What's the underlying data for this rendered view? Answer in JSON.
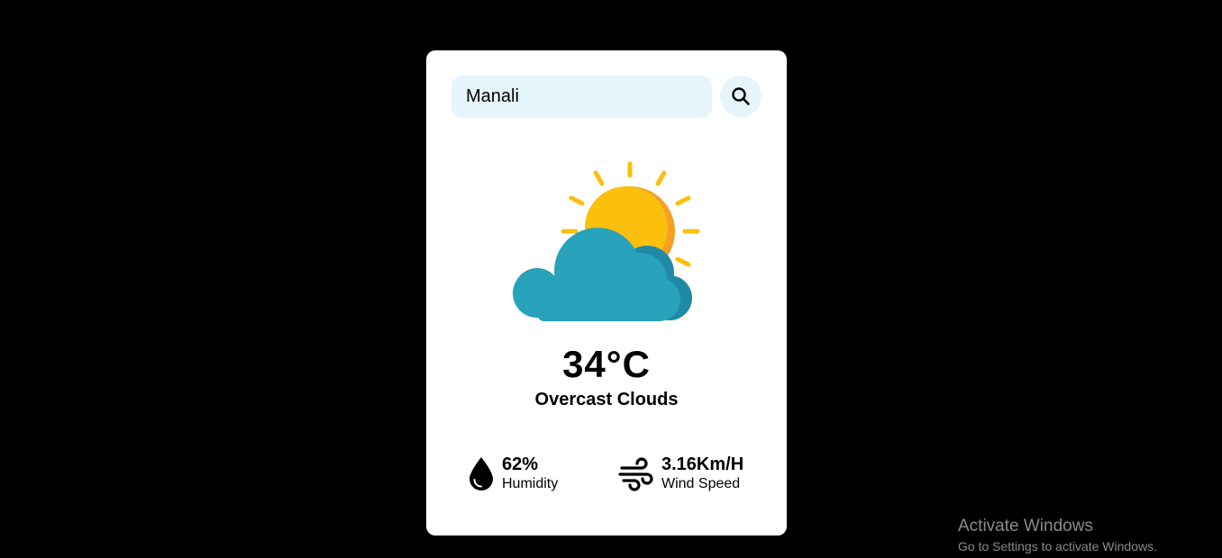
{
  "search": {
    "value": "Manali"
  },
  "weather": {
    "temperature": "34°C",
    "description": "Overcast Clouds",
    "icon": "partly-cloudy-icon"
  },
  "stats": {
    "humidity": {
      "value": "62%",
      "label": "Humidity",
      "icon": "water-drop-icon"
    },
    "wind": {
      "value": "3.16Km/H",
      "label": "Wind Speed",
      "icon": "wind-icon"
    }
  },
  "watermark": {
    "title": "Activate Windows",
    "subtitle": "Go to Settings to activate Windows."
  },
  "colors": {
    "background": "#000000",
    "card": "#ffffff",
    "input_bg": "#e6f4fb",
    "sun": "#fbbf0e",
    "sun_shade": "#f5a023",
    "cloud": "#29a3bc",
    "cloud_shade": "#1e8aa6"
  }
}
